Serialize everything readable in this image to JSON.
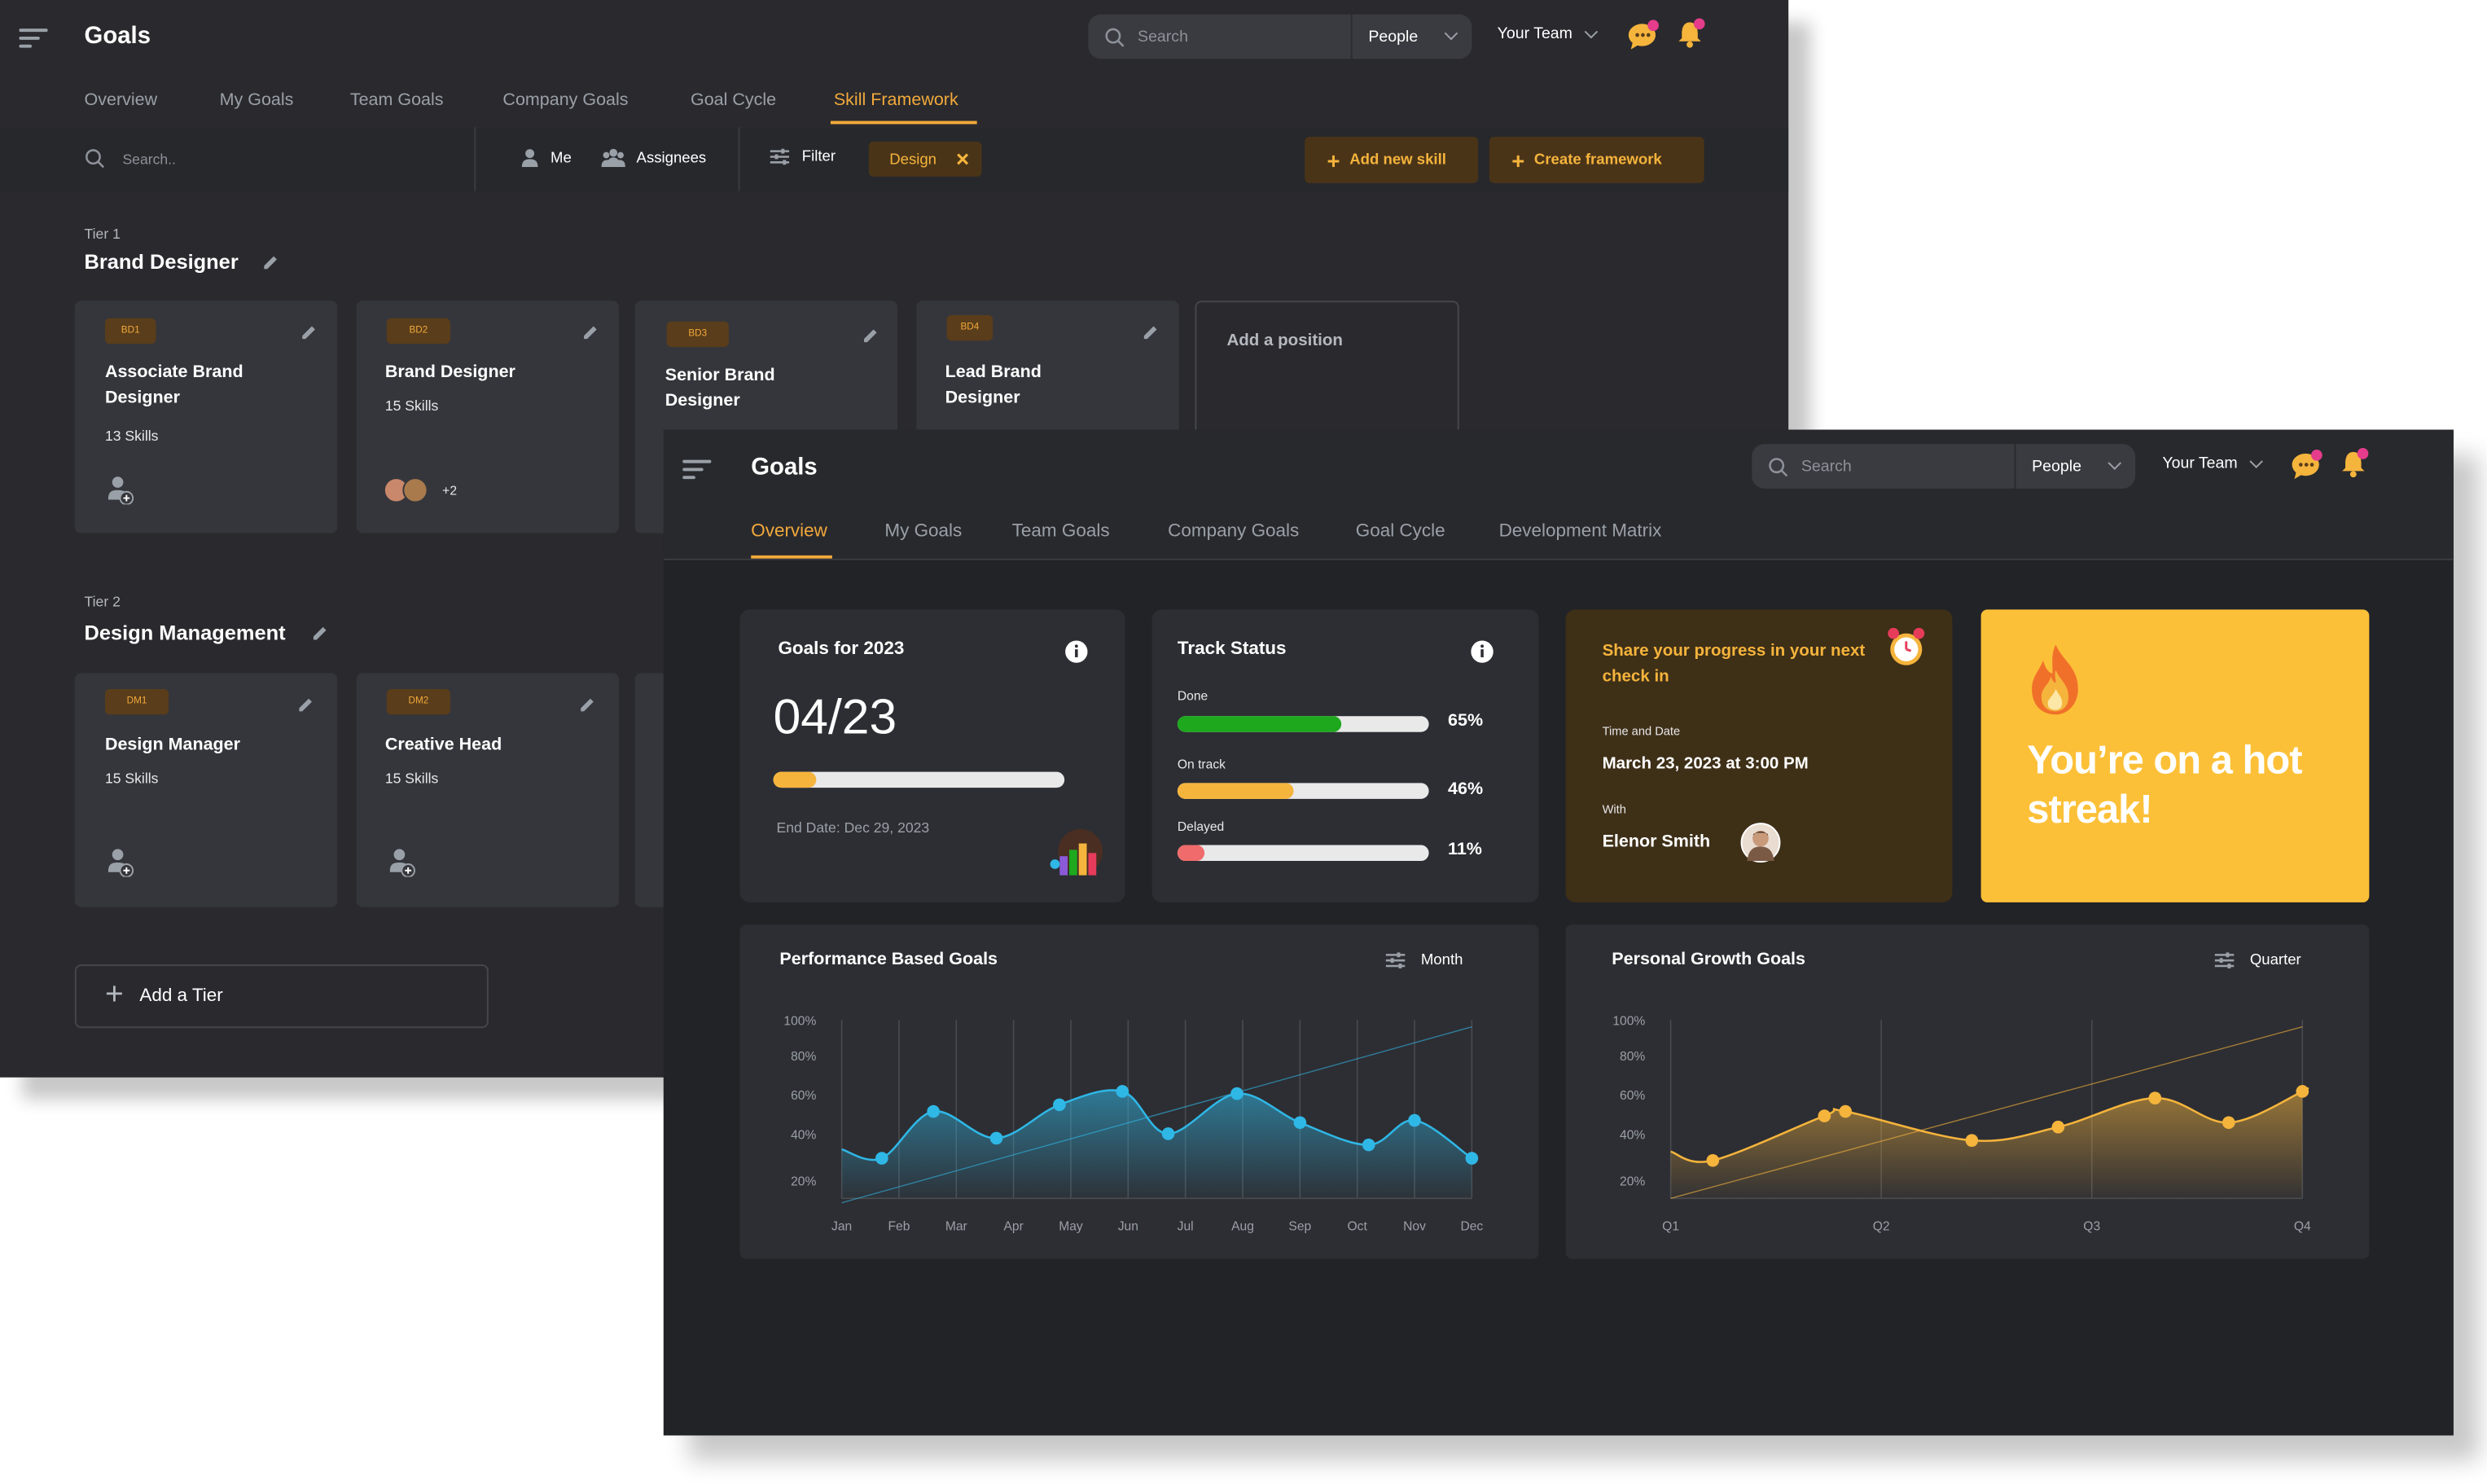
{
  "back": {
    "title": "Goals",
    "search_placeholder": "Search",
    "people_label": "People",
    "team_label": "Your Team",
    "tabs": [
      "Overview",
      "My Goals",
      "Team Goals",
      "Company Goals",
      "Goal Cycle",
      "Skill Framework"
    ],
    "toolbar": {
      "search_placeholder": "Search..",
      "me_label": "Me",
      "assignees_label": "Assignees",
      "filter_label": "Filter",
      "chip_label": "Design",
      "add_skill": "Add new skill",
      "create_framework": "Create framework"
    },
    "tiers": [
      {
        "tier_label": "Tier 1",
        "name": "Brand Designer",
        "positions": [
          {
            "code": "BD1",
            "title": "Associate Brand Designer",
            "skills": "13 Skills"
          },
          {
            "code": "BD2",
            "title": "Brand Designer",
            "skills": "15 Skills",
            "extra": "+2"
          },
          {
            "code": "BD3",
            "title": "Senior Brand Designer",
            "skills": ""
          },
          {
            "code": "BD4",
            "title": "Lead Brand Designer",
            "skills": ""
          }
        ],
        "add_position": "Add a position"
      },
      {
        "tier_label": "Tier 2",
        "name": "Design Management",
        "positions": [
          {
            "code": "DM1",
            "title": "Design Manager",
            "skills": "15 Skills"
          },
          {
            "code": "DM2",
            "title": "Creative Head",
            "skills": "15 Skills"
          }
        ]
      }
    ],
    "add_tier": "Add a Tier"
  },
  "front": {
    "title": "Goals",
    "search_placeholder": "Search",
    "people_label": "People",
    "team_label": "Your Team",
    "tabs": [
      "Overview",
      "My Goals",
      "Team Goals",
      "Company Goals",
      "Goal Cycle",
      "Development Matrix"
    ],
    "goals_card": {
      "title": "Goals for 2023",
      "value": "04/23",
      "progress": 0.15,
      "end_date": "End Date: Dec 29, 2023"
    },
    "track_status": {
      "title": "Track Status",
      "items": [
        {
          "label": "Done",
          "percent": "65%",
          "value": 0.65,
          "color": "#1ea81e"
        },
        {
          "label": "On track",
          "percent": "46%",
          "value": 0.46,
          "color": "#f5b43c"
        },
        {
          "label": "Delayed",
          "percent": "11%",
          "value": 0.11,
          "color": "#f06b6b"
        }
      ]
    },
    "checkin": {
      "heading": "Share your progress in your next check in",
      "time_label": "Time and Date",
      "time_value": "March 23, 2023 at 3:00 PM",
      "with_label": "With",
      "with_name": "Elenor Smith"
    },
    "streak": {
      "text": "You’re on a hot streak!"
    },
    "perf_chart_card": {
      "title": "Performance Based Goals",
      "period": "Month"
    },
    "growth_chart_card": {
      "title": "Personal Growth Goals",
      "period": "Quarter"
    }
  },
  "chart_data": [
    {
      "type": "area",
      "title": "Performance Based Goals",
      "categories": [
        "Jan",
        "Feb",
        "Mar",
        "Apr",
        "May",
        "Jun",
        "Jul",
        "Aug",
        "Sep",
        "Oct",
        "Nov",
        "Dec"
      ],
      "y_ticks": [
        "100%",
        "80%",
        "60%",
        "40%",
        "20%"
      ],
      "points_x": [
        0.7,
        1.6,
        2.7,
        3.8,
        4.9,
        5.7,
        6.9,
        8.0,
        9.2,
        10.0,
        11.0
      ],
      "points_y": [
        38,
        59,
        47,
        62,
        68,
        49,
        67,
        54,
        44,
        55,
        38
      ],
      "trend": [
        [
          0,
          18
        ],
        [
          11,
          97
        ]
      ],
      "ylim": [
        20,
        100
      ],
      "color": "#2fb7e6"
    },
    {
      "type": "area",
      "title": "Personal Growth Goals",
      "categories": [
        "Q1",
        "Q2",
        "Q3",
        "Q4"
      ],
      "y_ticks": [
        "100%",
        "80%",
        "60%",
        "40%",
        "20%"
      ],
      "points_x": [
        0.2,
        0.73,
        0.83,
        1.43,
        1.84,
        2.3,
        2.65,
        3.0
      ],
      "points_y": [
        37,
        57,
        59,
        46,
        52,
        65,
        54,
        68
      ],
      "trend": [
        [
          0,
          20
        ],
        [
          3,
          97
        ]
      ],
      "ylim": [
        20,
        100
      ],
      "color": "#f5b43c"
    }
  ]
}
